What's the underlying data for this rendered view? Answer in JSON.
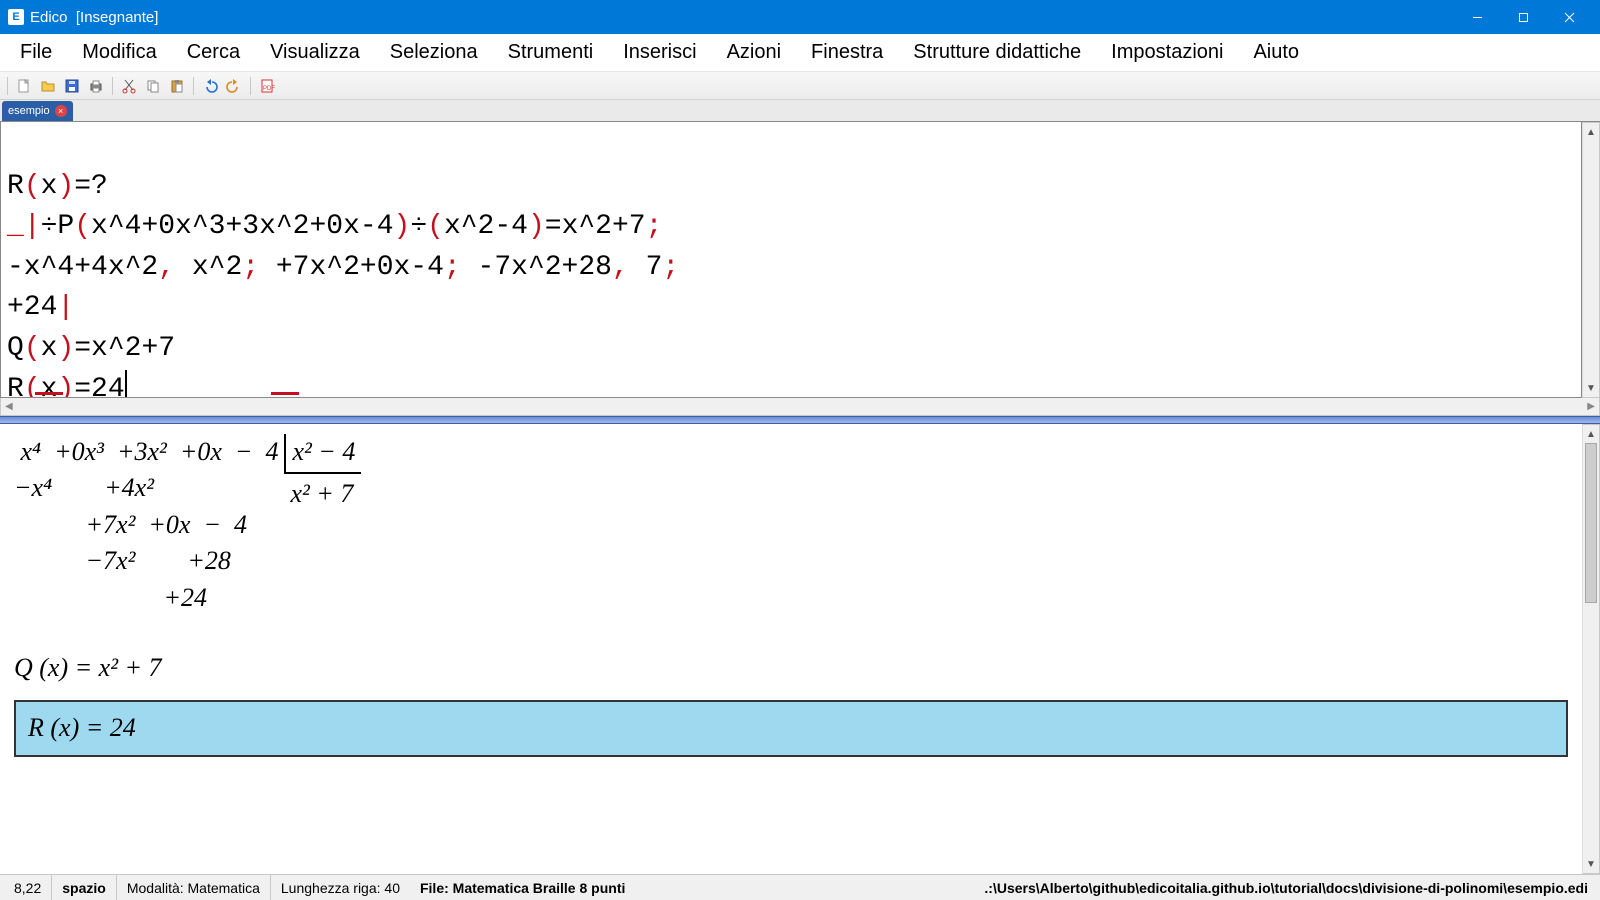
{
  "titlebar": {
    "app": "Edico",
    "context": "[Insegnante]"
  },
  "menu": [
    "File",
    "Modifica",
    "Cerca",
    "Visualizza",
    "Seleziona",
    "Strumenti",
    "Inserisci",
    "Azioni",
    "Finestra",
    "Strutture didattiche",
    "Impostazioni",
    "Aiuto"
  ],
  "toolbar_icons": [
    "new-file-icon",
    "open-folder-icon",
    "save-icon",
    "print-icon",
    "cut-icon",
    "copy-icon",
    "paste-icon",
    "undo-icon",
    "redo-icon",
    "pdf-icon"
  ],
  "tab": {
    "name": "esempio"
  },
  "editor_lines": {
    "l1_a": "R",
    "l1_b": "(",
    "l1_c": "x",
    "l1_d": ")",
    "l1_e": "=?",
    "l2_a": "_",
    "l2_b": "|",
    "l2_c": "÷P",
    "l2_d": "(",
    "l2_e": "x^4+0x^3+3x^2+0x-4",
    "l2_f": ")",
    "l2_g": "÷",
    "l2_h": "(",
    "l2_i": "x^2-4",
    "l2_j": ")",
    "l2_k": "=x^2+7",
    "l2_l": ";",
    "l3_a": "-x^4+4x^2",
    "l3_b": ",",
    "l3_c": " x^2",
    "l3_d": ";",
    "l3_e": " +7x^2+0x-4",
    "l3_f": ";",
    "l3_g": " -7x^2+28",
    "l3_h": ",",
    "l3_i": " 7",
    "l3_j": ";",
    "l4_a": "+24",
    "l4_b": "|",
    "l5_a": "Q",
    "l5_b": "(",
    "l5_c": "x",
    "l5_d": ")",
    "l5_e": "=x^2+7",
    "l6_a": "R",
    "l6_b": "(",
    "l6_c": "x",
    "l6_d": ")",
    "l6_e": "=24"
  },
  "preview": {
    "div_top": "x² − 4",
    "div_bot": "x² + 7",
    "rows": {
      "r1": " x⁴  +0x³  +3x²  +0x  −  4",
      "r2": "−x⁴        +4x²",
      "r3": "           +7x²  +0x  −  4",
      "r4": "           −7x²        +28",
      "r5": "                       +24"
    },
    "q_label": "Q (x) = x² + 7",
    "r_label": "R (x) = 24"
  },
  "statusbar": {
    "pos": "8,22",
    "key": "spazio",
    "mode": "Modalità: Matematica",
    "len": "Lunghezza riga: 40",
    "file": "File: Matematica  Braille 8 punti",
    "path": ".:\\Users\\Alberto\\github\\edicoitalia.github.io\\tutorial\\docs\\divisione-di-polinomi\\esempio.edi"
  }
}
